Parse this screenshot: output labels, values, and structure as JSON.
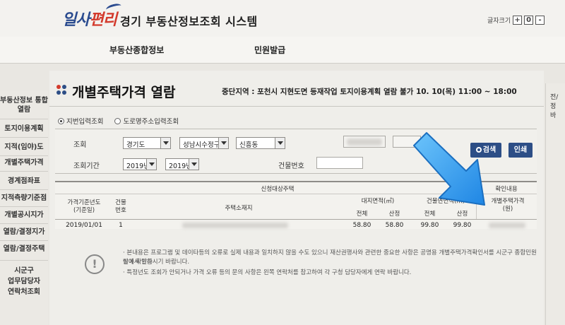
{
  "header": {
    "logo_part1": "일사",
    "logo_part2": "편리",
    "system_title": "경기 부동산정보조회 시스템",
    "font_size_label": "글자크기",
    "font_plus": "+",
    "font_reset": "0",
    "font_minus": "-"
  },
  "nav": {
    "items": [
      "부동산종합정보",
      "민원발급"
    ]
  },
  "sidebar": {
    "items": [
      "부동산정보 통합\n열람",
      "토지이용계획",
      "지적(임야)도",
      "개별주택가격",
      "경계점좌표",
      "지적측량기준점",
      "개별공시지가",
      "열람/결정지가",
      "열람/결정주택"
    ],
    "bottom": "시군구\n업무담당자\n연락처조회"
  },
  "right_strip": {
    "text": "전/\n정\n바"
  },
  "page": {
    "title": "개별주택가격 열람",
    "notice": "중단지역 : 포천시 지현도면 등재작업 토지이용계획 열람 불가 10. 10(목) 11:00 ~ 18:00"
  },
  "search": {
    "radio_lot": "지번입력조회",
    "radio_road": "도로명주소입력조회",
    "label_query": "조회",
    "sido": "경기도",
    "sigungu": "성남시수정구",
    "dong": "신흥동",
    "label_period": "조회기간",
    "year_from": "2019년",
    "year_to": "2019년",
    "label_building": "건물번호",
    "search_button": "검색",
    "print_button": "인쇄"
  },
  "table": {
    "group_header": "신청대상주택",
    "result_header": "확인내용",
    "col_base_year": "가격기준년도\n(기준일)",
    "col_building_no": "건물\n번호",
    "col_address": "주택소재지",
    "col_land_area": "대지면적(㎡)",
    "col_building_area": "건물연면적(㎡)",
    "col_total": "전체",
    "col_applied": "산정",
    "col_price": "개별주택가격\n(원)",
    "rows": [
      {
        "base_year": "2019/01/01",
        "building_no": "1",
        "land_total": "58.80",
        "land_applied": "58.80",
        "bldg_total": "99.80",
        "bldg_applied": "99.80"
      }
    ]
  },
  "info": {
    "icon": "!",
    "line1": "· 본내용은 프로그램 및 데이타등의 오류로 실제 내용과 일치하지 않을 수도 있으니 재산권행사와 관련한 중요한 사항은 공명용 개별주택가격확인서를 시군구 종합민원실에서 발급",
    "line2": "받아 확인하시기 바랍니다.",
    "line3": "· 특정년도 조회가 안되거나 가격 오류 등의 문의 사항은 왼쪽 연락처를 참고하여 각 구청 담당자에게 연락 바랍니다."
  },
  "colors": {
    "accent": "#2d4e86",
    "logo_blue": "#2a4b8f",
    "logo_red": "#d33a2c",
    "arrow": "#3aa0f0"
  }
}
